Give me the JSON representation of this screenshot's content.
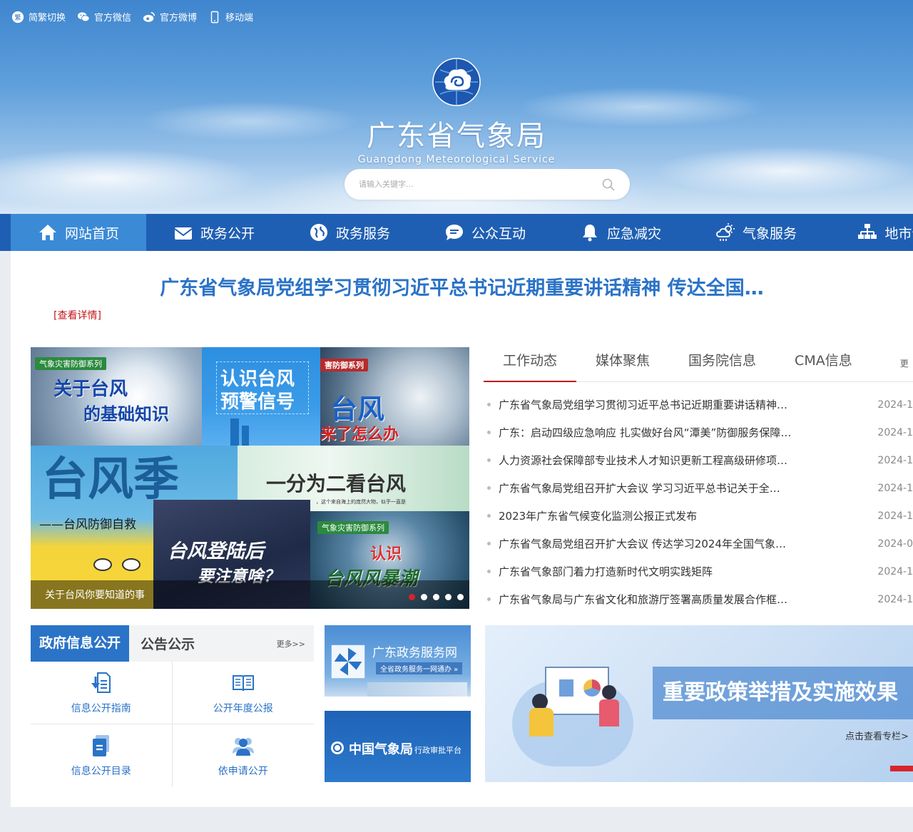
{
  "topbar": {
    "items": [
      {
        "label": "简繁切换",
        "icon": "traditional-chinese-icon"
      },
      {
        "label": "官方微信",
        "icon": "wechat-icon"
      },
      {
        "label": "官方微博",
        "icon": "weibo-icon"
      },
      {
        "label": "移动端",
        "icon": "mobile-icon"
      }
    ]
  },
  "header": {
    "title_cn": "广东省气象局",
    "title_en": "Guangdong Meteorological Service",
    "search_placeholder": "请输入关键字..."
  },
  "nav": {
    "items": [
      {
        "label": "网站首页",
        "icon": "home-icon",
        "active": true
      },
      {
        "label": "政务公开",
        "icon": "mail-icon"
      },
      {
        "label": "政务服务",
        "icon": "globe-icon"
      },
      {
        "label": "公众互动",
        "icon": "chat-icon"
      },
      {
        "label": "应急减灾",
        "icon": "bell-icon"
      },
      {
        "label": "气象服务",
        "icon": "weather-icon"
      },
      {
        "label": "地市气",
        "icon": "sitemap-icon"
      }
    ]
  },
  "headline": {
    "text": "广东省气象局党组学习贯彻习近平总书记近期重要讲话精神 传达全国…",
    "detail": "[查看详情]"
  },
  "carousel": {
    "caption": "关于台风你要知道的事",
    "slide_count": 5,
    "active_index": 0,
    "tiles": {
      "t1_tag": "气象灾害防御系列",
      "t1_line1": "关于台风",
      "t1_line2": "的基础知识",
      "t2_line1": "认识台风",
      "t2_line2": "预警信号",
      "t3_tag": "害防御系列",
      "t3_line1": "台风",
      "t3_line2": "来了怎么办",
      "t4_big": "台风季",
      "t4_sub": "——台风防御自救",
      "t5_text": "一分为二看台风",
      "t5_small": "，这个来自海上的庞然大物，似乎一直是",
      "t6_line1": "台风登陆后",
      "t6_line2": "要注意啥？",
      "t7_tag": "气象灾害防御系列",
      "t7_line1": "认识",
      "t7_line2": "台风风暴潮"
    }
  },
  "news": {
    "tabs": [
      "工作动态",
      "媒体聚焦",
      "国务院信息",
      "CMA信息"
    ],
    "active_tab": 0,
    "more": "更",
    "items": [
      {
        "title": "广东省气象局党组学习贯彻习近平总书记近期重要讲话精神…",
        "date": "2024-1"
      },
      {
        "title": "广东：启动四级应急响应 扎实做好台风“潭美”防御服务保障…",
        "date": "2024-1"
      },
      {
        "title": "人力资源社会保障部专业技术人才知识更新工程高级研修项…",
        "date": "2024-1"
      },
      {
        "title": "广东省气象局党组召开扩大会议 学习习近平总书记关于全…",
        "date": "2024-1"
      },
      {
        "title": "2023年广东省气候变化监测公报正式发布",
        "date": "2024-1"
      },
      {
        "title": "广东省气象局党组召开扩大会议 传达学习2024年全国气象…",
        "date": "2024-0"
      },
      {
        "title": "广东省气象部门着力打造新时代文明实践矩阵",
        "date": "2024-1"
      },
      {
        "title": "广东省气象局与广东省文化和旅游厅签署高质量发展合作框…",
        "date": "2024-1"
      }
    ]
  },
  "gov": {
    "tab_active": "政府信息公开",
    "tab_other": "公告公示",
    "more": "更多>>",
    "cells": [
      {
        "label": "信息公开指南",
        "icon": "download-doc-icon"
      },
      {
        "label": "公开年度公报",
        "icon": "book-icon"
      },
      {
        "label": "信息公开目录",
        "icon": "document-list-icon"
      },
      {
        "label": "依申请公开",
        "icon": "users-icon"
      }
    ]
  },
  "side_banners": {
    "b1_title": "广东政务服务网",
    "b1_sub": "全省政务服务一网通办 »",
    "b2_title": "中国气象局",
    "b2_sub": "行政审批平台"
  },
  "policy": {
    "title": "重要政策举措及实施效果",
    "link": "点击查看专栏>"
  },
  "colors": {
    "nav_bg": "#1f5fb3",
    "nav_active": "#3b8ad6",
    "headline": "#2a73c7",
    "accent_red": "#c3151a"
  }
}
